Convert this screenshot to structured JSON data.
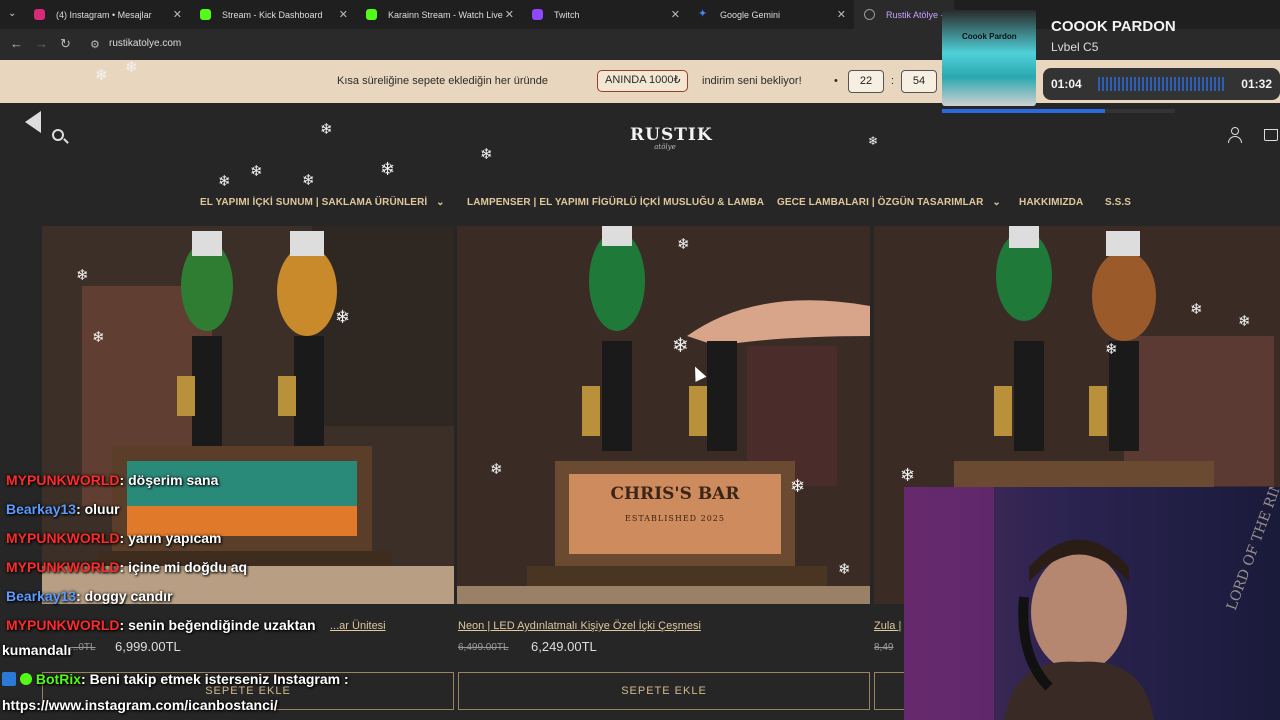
{
  "tabs": [
    {
      "label": "(4) Instagram • Mesajlar",
      "fav_color": "#d62976"
    },
    {
      "label": "Stream - Kick Dashboard",
      "fav_color": "#53fc18"
    },
    {
      "label": "Karainn Stream - Watch Live on",
      "fav_color": "#53fc18"
    },
    {
      "label": "Twitch",
      "fav_color": "#9146ff"
    },
    {
      "label": "Google Gemini",
      "fav_color": "#4285f4"
    },
    {
      "label": "Rustik Atölye - K",
      "fav_color": "#888888"
    }
  ],
  "address": {
    "url": "rustikatolye.com"
  },
  "promo": {
    "text_before": "Kısa süreliğine sepete eklediğin her üründe",
    "pill": "ANINDA 1000₺",
    "text_after": "indirim seni bekliyor!",
    "bullet": "•",
    "timer_a": "22",
    "timer_sep": ":",
    "timer_b": "54"
  },
  "header": {
    "logo_main": "RUSTIK",
    "logo_sub": "atölye"
  },
  "nav": [
    {
      "label": "EL YAPIMI İÇKİ SUNUM | SAKLAMA ÜRÜNLERİ",
      "chevron": true
    },
    {
      "label": "LAMPENSER | EL YAPIMI FİGÜRLÜ İÇKİ MUSLUĞU & LAMBA",
      "chevron": false
    },
    {
      "label": "GECE LAMBALARI | ÖZGÜN TASARIMLAR",
      "chevron": true
    },
    {
      "label": "HAKKIMIZDA",
      "chevron": false
    },
    {
      "label": "S.S.S",
      "chevron": false
    }
  ],
  "products": [
    {
      "title": "...ar Ünitesi",
      "old_price": "...0TL",
      "price": "6,999.00TL",
      "button": "SEPETE EKLE"
    },
    {
      "title": "Neon | LED Aydınlatmalı Kişiye Özel İçki Çeşmesi",
      "old_price": "6,499.00TL",
      "price": "6,249.00TL",
      "button": "SEPETE EKLE",
      "sign_line1": "CHRIS'S BAR",
      "sign_line2": "ESTABLISHED 2025"
    },
    {
      "title": "Zula |",
      "old_price": "8,49",
      "price": "",
      "button": ""
    }
  ],
  "music": {
    "title": "COOOK PARDON",
    "artist": "Lvbel C5",
    "elapsed": "01:04",
    "total": "01:32",
    "progress": 0.7,
    "cover_text": "Coook Pardon"
  },
  "chat": [
    {
      "user": "MYPUNKWORLD",
      "user_color": "#ff2a2a",
      "msg": ": döşerim sana"
    },
    {
      "user": "Bearkay13",
      "user_color": "#5a9cff",
      "msg": ": oluur"
    },
    {
      "user": "MYPUNKWORLD",
      "user_color": "#ff2a2a",
      "msg": ": yarın yapıcam"
    },
    {
      "user": "MYPUNKWORLD",
      "user_color": "#ff2a2a",
      "msg": ": içine mi doğdu aq"
    },
    {
      "user": "Bearkay13",
      "user_color": "#5a9cff",
      "msg": ": doggy candır"
    },
    {
      "user": "MYPUNKWORLD",
      "user_color": "#ff2a2a",
      "msg": ": senin beğendiğinde uzaktan"
    },
    {
      "user": "",
      "user_color": "#ffffff",
      "msg": "kumandalı"
    },
    {
      "user": "BotRix",
      "user_color": "#53fc18",
      "msg": ": Beni takip etmek isterseniz Instagram :"
    },
    {
      "user": "",
      "user_color": "#ffffff",
      "msg": "https://www.instagram.com/icanbostanci/"
    }
  ],
  "webcam": {
    "poster_text": "LORD OF THE RINGS"
  },
  "colors": {
    "promo_bg": "#e8d7be",
    "nav_gold": "#e0c79c",
    "page_bg": "#262626"
  }
}
